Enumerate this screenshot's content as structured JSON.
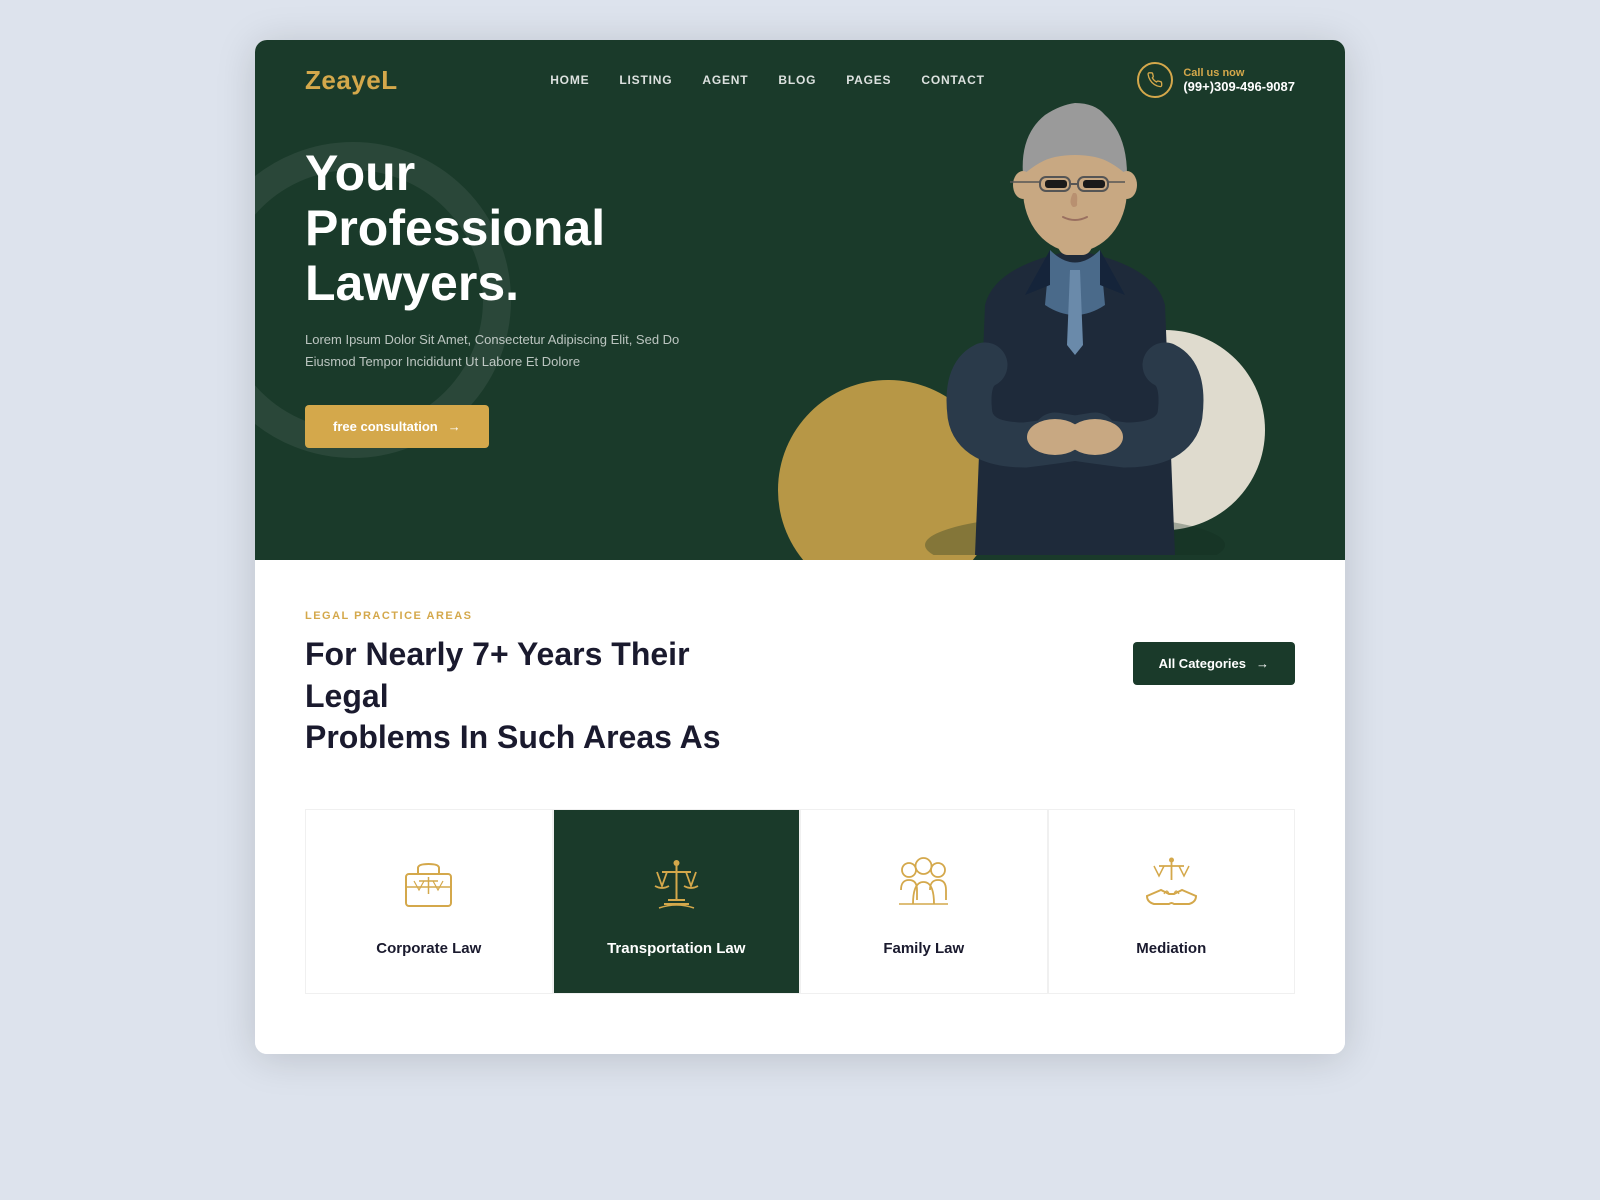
{
  "logo": {
    "part1": "Zea",
    "part2": "ye",
    "part3": "L"
  },
  "nav": {
    "links": [
      {
        "label": "HOME",
        "id": "home"
      },
      {
        "label": "LISTING",
        "id": "listing"
      },
      {
        "label": "AGENT",
        "id": "agent"
      },
      {
        "label": "BLOG",
        "id": "blog"
      },
      {
        "label": "PAGES",
        "id": "pages"
      },
      {
        "label": "CONTACT",
        "id": "contact"
      }
    ],
    "call_label": "Call us now",
    "phone": "(99+)309-496-9087"
  },
  "hero": {
    "title_line1": "Your Professional",
    "title_line2": "Lawyers.",
    "subtitle": "Lorem Ipsum Dolor Sit Amet, Consectetur Adipiscing Elit, Sed Do Eiusmod Tempor Incididunt Ut Labore Et Dolore",
    "btn_label": "free Consultation",
    "btn_arrow": "→"
  },
  "practice": {
    "tag": "LEGAL PRACTICE AREAS",
    "title_line1": "For Nearly 7+ Years Their Legal",
    "title_line2": "Problems In Such Areas As",
    "all_categories_label": "All Categories",
    "all_categories_arrow": "→",
    "areas": [
      {
        "id": "corporate",
        "label": "Corporate Law",
        "active": false
      },
      {
        "id": "transportation",
        "label": "Transportation Law",
        "active": true
      },
      {
        "id": "family",
        "label": "Family Law",
        "active": false
      },
      {
        "id": "mediation",
        "label": "Mediation",
        "active": false
      }
    ]
  },
  "colors": {
    "brand_dark": "#1a3a2a",
    "brand_gold": "#d4a84b",
    "white": "#ffffff"
  }
}
